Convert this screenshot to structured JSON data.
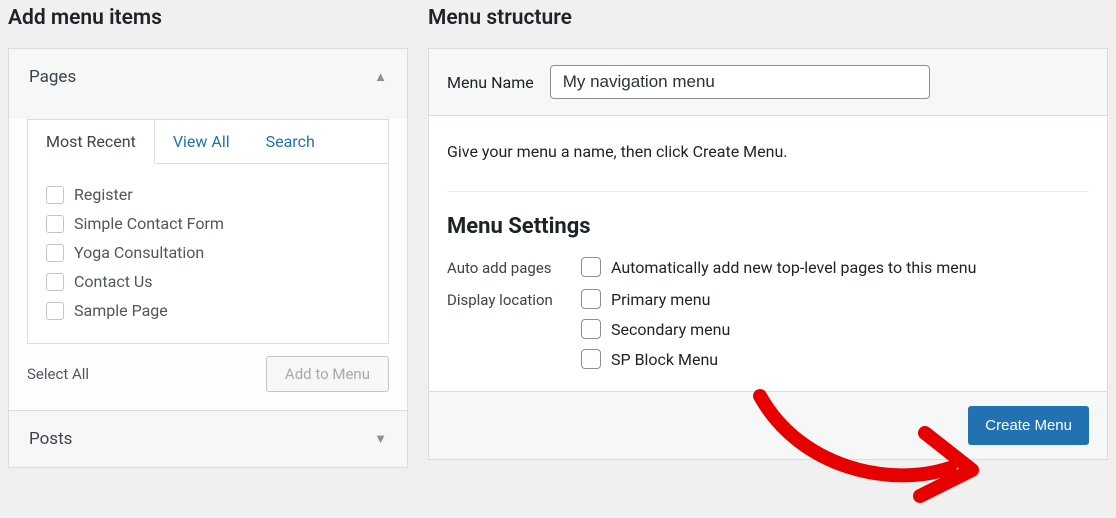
{
  "left": {
    "heading": "Add menu items",
    "pages_panel_label": "Pages",
    "tabs": {
      "recent": "Most Recent",
      "all": "View All",
      "search": "Search"
    },
    "page_items": [
      "Register",
      "Simple Contact Form",
      "Yoga Consultation",
      "Contact Us",
      "Sample Page"
    ],
    "select_all": "Select All",
    "add_to_menu": "Add to Menu",
    "posts_panel_label": "Posts"
  },
  "right": {
    "heading": "Menu structure",
    "menu_name_label": "Menu Name",
    "menu_name_value": "My navigation menu",
    "intro": "Give your menu a name, then click Create Menu.",
    "settings_title": "Menu Settings",
    "auto_add_label": "Auto add pages",
    "auto_add_option": "Automatically add new top-level pages to this menu",
    "display_location_label": "Display location",
    "display_locations": [
      "Primary menu",
      "Secondary menu",
      "SP Block Menu"
    ],
    "create_button": "Create Menu"
  }
}
